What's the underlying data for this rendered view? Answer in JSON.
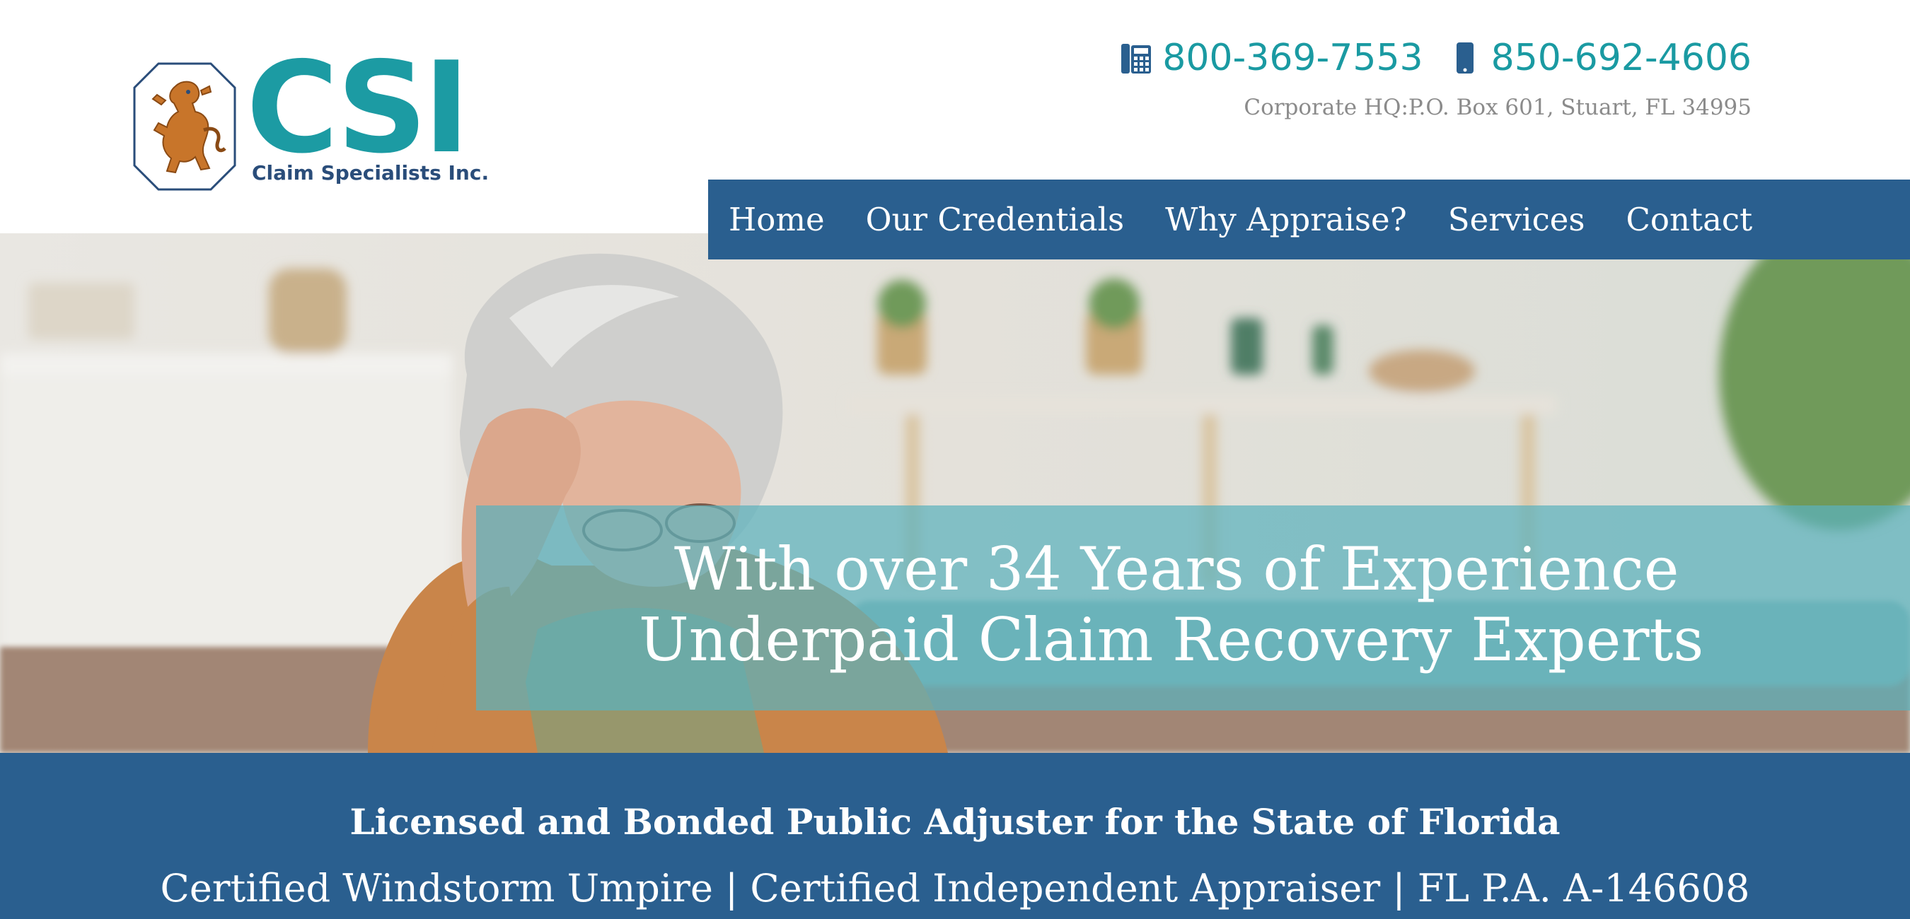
{
  "logo": {
    "mark": "CSI",
    "subtitle": "Claim Specialists Inc."
  },
  "contact": {
    "phone_office": "800-369-7553",
    "phone_mobile": "850-692-4606",
    "office_icon": "office-phone-icon",
    "mobile_icon": "mobile-phone-icon",
    "address": "Corporate HQ:P.O. Box 601, Stuart, FL 34995"
  },
  "nav": {
    "items": [
      {
        "label": "Home"
      },
      {
        "label": "Our Credentials"
      },
      {
        "label": "Why Appraise?"
      },
      {
        "label": "Services"
      },
      {
        "label": "Contact"
      }
    ]
  },
  "hero": {
    "line1": "With over 34 Years of Experience",
    "line2": "Underpaid Claim Recovery Experts"
  },
  "band": {
    "line1": "Licensed and Bonded Public Adjuster for the State of Florida",
    "line2": "Certified Windstorm Umpire | Certified Independent Appraiser | FL P.A. A-146608"
  },
  "colors": {
    "teal": "#1c9ba3",
    "navy": "#2a5f8f",
    "crest_orange": "#c8752a",
    "address_gray": "#8b8b8b"
  }
}
